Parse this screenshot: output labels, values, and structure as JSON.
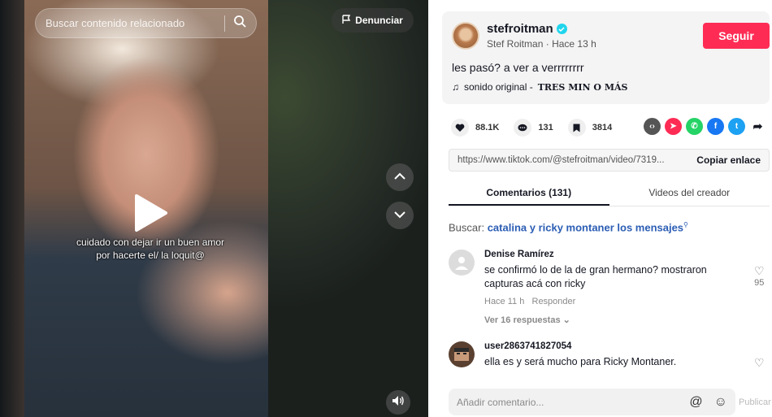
{
  "video": {
    "search_placeholder": "Buscar contenido relacionado",
    "report_label": "Denunciar",
    "caption": "cuidado con dejar ir un buen amor por hacerte el/ la loquit@"
  },
  "author": {
    "username": "stefroitman",
    "display_name": "Stef Roitman",
    "time_ago": "Hace 13 h",
    "follow_label": "Seguir",
    "description": "les pasó? a ver a verrrrrrrr",
    "sound_prefix": "sonido original - ",
    "sound_name": "TRES MIN O MÁS"
  },
  "stats": {
    "likes": "88.1K",
    "comments": "131",
    "saves": "3814"
  },
  "share": {
    "icons": [
      "embed-icon",
      "send-icon",
      "whatsapp-icon",
      "facebook-icon",
      "twitter-icon",
      "share-arrow-icon"
    ],
    "colors": {
      "embed": "#555555",
      "send": "#fe2c55",
      "whatsapp": "#25d366",
      "facebook": "#1877f2",
      "twitter": "#1da1f2"
    }
  },
  "link": {
    "url": "https://www.tiktok.com/@stefroitman/video/7319...",
    "copy_label": "Copiar enlace"
  },
  "tabs": {
    "comments": "Comentarios (131)",
    "creator_videos": "Videos del creador"
  },
  "search_suggestion": {
    "prefix": "Buscar:",
    "query": "catalina y ricky montaner los mensajes"
  },
  "comments": [
    {
      "name": "Denise Ramírez",
      "text": "se confirmó lo de la de gran hermano? mostraron capturas acá con ricky",
      "time": "Hace 11 h",
      "reply": "Responder",
      "more": "Ver 16 respuestas",
      "likes": "95"
    },
    {
      "name": "user2863741827054",
      "text": "ella es y será mucho para Ricky Montaner."
    }
  ],
  "comment_bar": {
    "placeholder": "Añadir comentario...",
    "post_label": "Publicar"
  },
  "colors": {
    "accent": "#fe2c55",
    "verified": "#20d5ec",
    "link": "#2b5db4"
  }
}
